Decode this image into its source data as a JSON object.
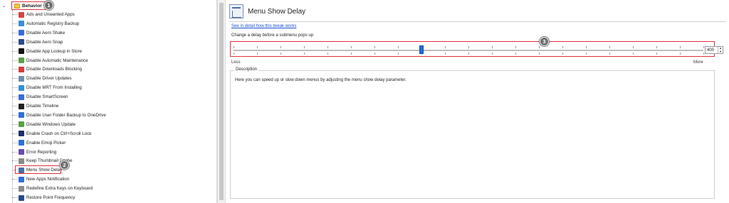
{
  "tree": {
    "root_label": "Behavior",
    "items": [
      {
        "label": "Ads and Unwanted Apps",
        "icon": "ads-icon",
        "color": "#d64545"
      },
      {
        "label": "Automatic Registry Backup",
        "icon": "registry-icon",
        "color": "#3a8dd6"
      },
      {
        "label": "Disable Aero Shake",
        "icon": "window-icon",
        "color": "#3a6bd6"
      },
      {
        "label": "Disable Aero Snap",
        "icon": "window-snap-icon",
        "color": "#2b4a8a"
      },
      {
        "label": "Disable App Lookup in Store",
        "icon": "store-icon",
        "color": "#111111"
      },
      {
        "label": "Disable Automatic Maintenance",
        "icon": "maintenance-icon",
        "color": "#5aa04a"
      },
      {
        "label": "Disable Downloads Blocking",
        "icon": "download-block-icon",
        "color": "#d63b3b"
      },
      {
        "label": "Disable Driver Updates",
        "icon": "driver-icon",
        "color": "#6f8fa8"
      },
      {
        "label": "Disable MRT From Installing",
        "icon": "mrt-icon",
        "color": "#3a8dd6"
      },
      {
        "label": "Disable SmartScreen",
        "icon": "shield-icon",
        "color": "#3a6bd6"
      },
      {
        "label": "Disable Timeline",
        "icon": "timeline-icon",
        "color": "#222222"
      },
      {
        "label": "Disable User Folder Backup to OneDrive",
        "icon": "onedrive-icon",
        "color": "#2f6fd6"
      },
      {
        "label": "Disable Windows Update",
        "icon": "windows-update-icon",
        "color": "#5aa04a"
      },
      {
        "label": "Enable Crash on Ctrl+Scroll Lock",
        "icon": "crash-icon",
        "color": "#1f2f6a"
      },
      {
        "label": "Enable Emoji Picker",
        "icon": "emoji-icon",
        "color": "#2f6fd6"
      },
      {
        "label": "Error Reporting",
        "icon": "error-report-icon",
        "color": "#6a4ab0"
      },
      {
        "label": "Keep Thumbnail Cache",
        "icon": "thumbnail-icon",
        "color": "#8a8a8a"
      },
      {
        "label": "Menu Show Delay",
        "icon": "menu-delay-icon",
        "color": "#4a6da8"
      },
      {
        "label": "New Apps Notification",
        "icon": "notification-icon",
        "color": "#2f6fd6"
      },
      {
        "label": "Redefine Extra Keys on Keyboard",
        "icon": "keyboard-icon",
        "color": "#8a8a8a"
      },
      {
        "label": "Restore Point Frequency",
        "icon": "restore-icon",
        "color": "#2b4a8a"
      }
    ]
  },
  "badges": {
    "one": "1",
    "two": "2",
    "three": "3"
  },
  "detail": {
    "title": "Menu Show Delay",
    "link": "See in detail how this tweak works",
    "slider_caption": "Change a delay before a submenu pops up",
    "slider_value": "400",
    "slider_fraction": 0.4,
    "less_label": "Less",
    "more_label": "More",
    "description_legend": "Description",
    "description_text": "Here you can speed up or slow down menus by adjusting the menu show delay parameter."
  },
  "colors": {
    "highlight": "#e0303c",
    "slider_thumb": "#1e6fd9",
    "link": "#1a4fd6",
    "badge": "#6d6d6d"
  }
}
